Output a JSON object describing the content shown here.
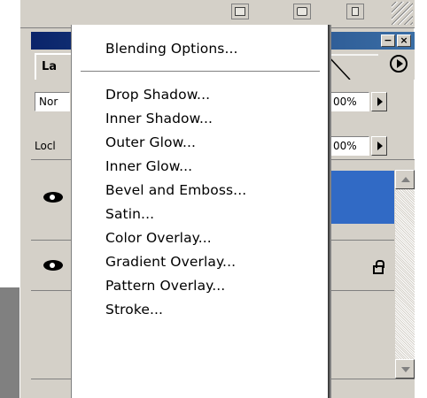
{
  "panel": {
    "tab_label": "La",
    "blend_mode": "Nor",
    "opacity": "00%",
    "lock_label": "Locl",
    "fill": "00%",
    "selected_color": "#316ac5",
    "title_color": "#0a246a"
  },
  "window_buttons": {
    "minimize": "−",
    "close": "×"
  },
  "menu": {
    "blending_options": "Blending Options...",
    "items": [
      "Drop Shadow...",
      "Inner Shadow...",
      "Outer Glow...",
      "Inner Glow...",
      "Bevel and Emboss...",
      "Satin...",
      "Color Overlay...",
      "Gradient Overlay...",
      "Pattern Overlay...",
      "Stroke..."
    ]
  },
  "icons": {
    "toolbar": [
      "new-layer-icon",
      "mask-icon",
      "trash-icon"
    ],
    "flyout": "flyout-arrow-icon",
    "visibility": "eye-icon",
    "lock": "lock-icon"
  }
}
